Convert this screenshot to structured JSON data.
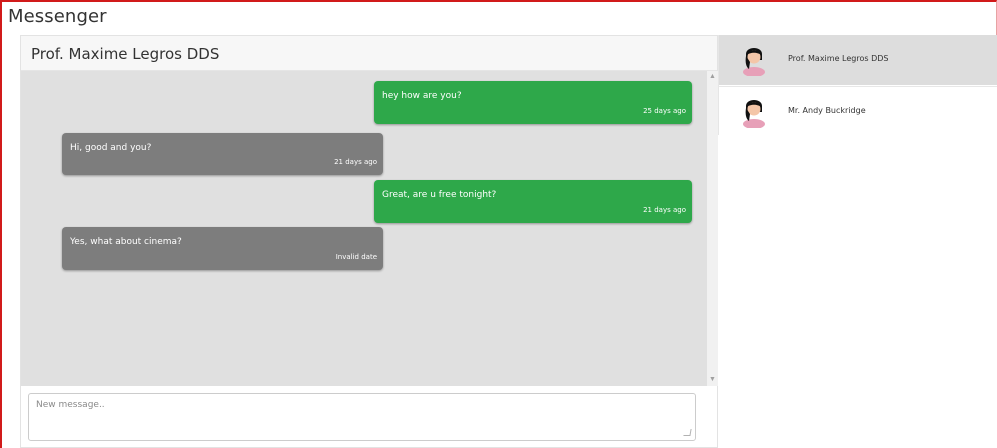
{
  "app": {
    "title": "Messenger"
  },
  "chat": {
    "title": "Prof. Maxime Legros DDS",
    "messages": [
      {
        "direction": "sent",
        "text": "hey how are you?",
        "time": "25 days ago"
      },
      {
        "direction": "received",
        "text": "Hi, good and you?",
        "time": "21 days ago"
      },
      {
        "direction": "sent",
        "text": "Great, are u free tonight?",
        "time": "21 days ago"
      },
      {
        "direction": "received",
        "text": "Yes, what about cinema?",
        "time": "Invalid date"
      }
    ]
  },
  "composer": {
    "placeholder": "New message..",
    "value": ""
  },
  "contacts": [
    {
      "name": "Prof. Maxime Legros DDS",
      "active": true,
      "avatar": "avatar-icon"
    },
    {
      "name": "Mr. Andy Buckridge",
      "active": false,
      "avatar": "avatar-icon"
    }
  ],
  "colors": {
    "sent_bubble": "#2ea84a",
    "received_bubble": "#7d7d7d",
    "messages_background": "#e0e0e0",
    "active_contact": "#dddddd",
    "frame_border": "#d11a1a"
  },
  "icons": {
    "scroll_up": "chevron-up-icon",
    "scroll_down": "chevron-down-icon",
    "resize": "resize-grip-icon"
  }
}
